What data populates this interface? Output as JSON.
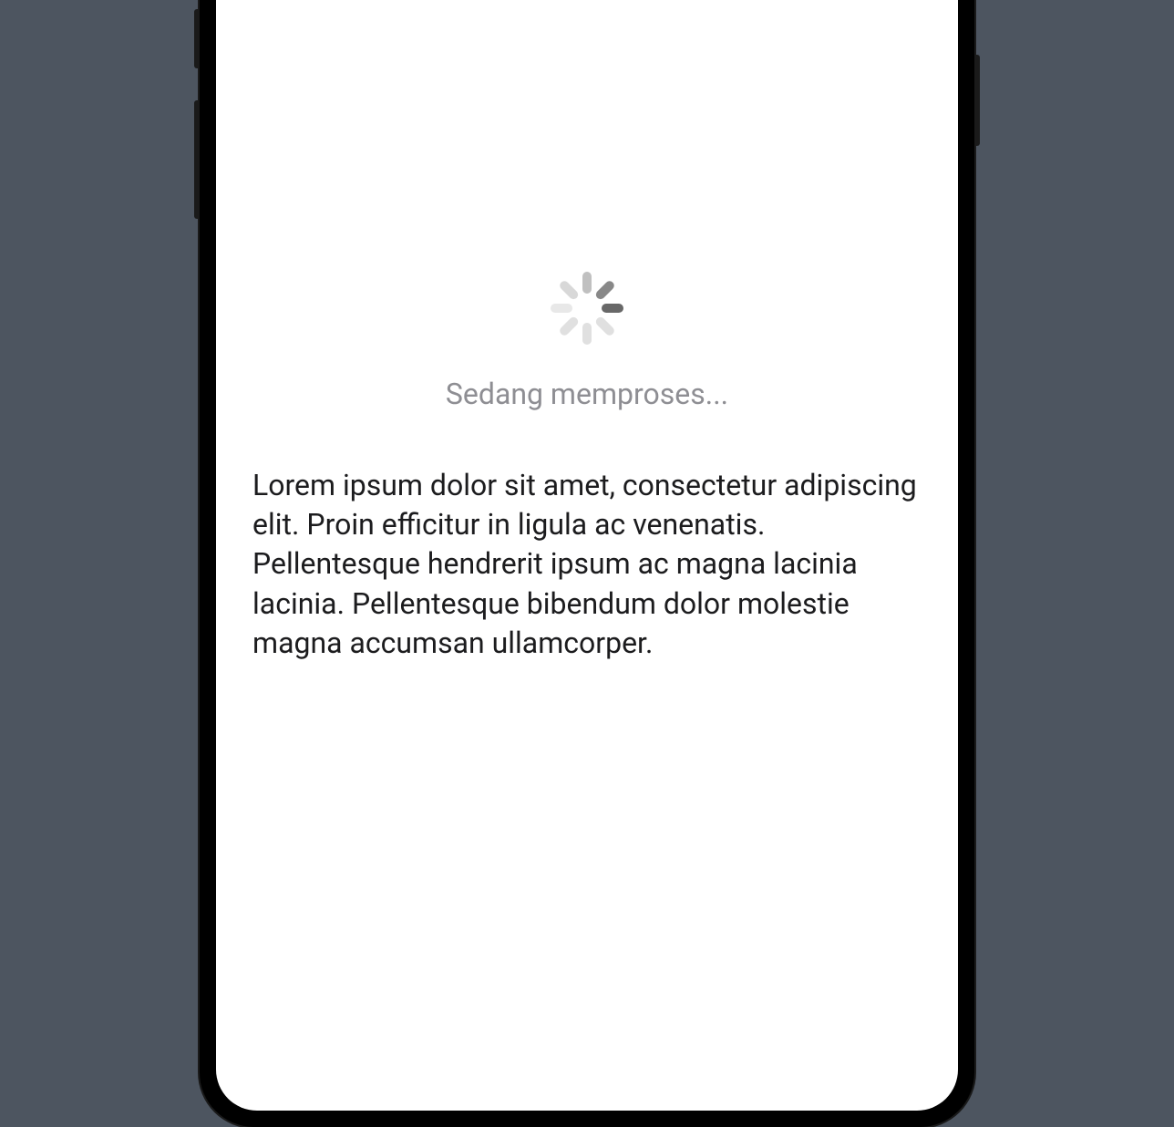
{
  "loading": {
    "status_text": "Sedang memproses..."
  },
  "content": {
    "body_text": "Lorem ipsum dolor sit amet, consectetur adipiscing elit. Proin efficitur in ligula ac venenatis. Pellentesque hendrerit ipsum ac magna lacinia lacinia. Pellentesque bibendum dolor molestie magna accumsan ullamcorper."
  }
}
